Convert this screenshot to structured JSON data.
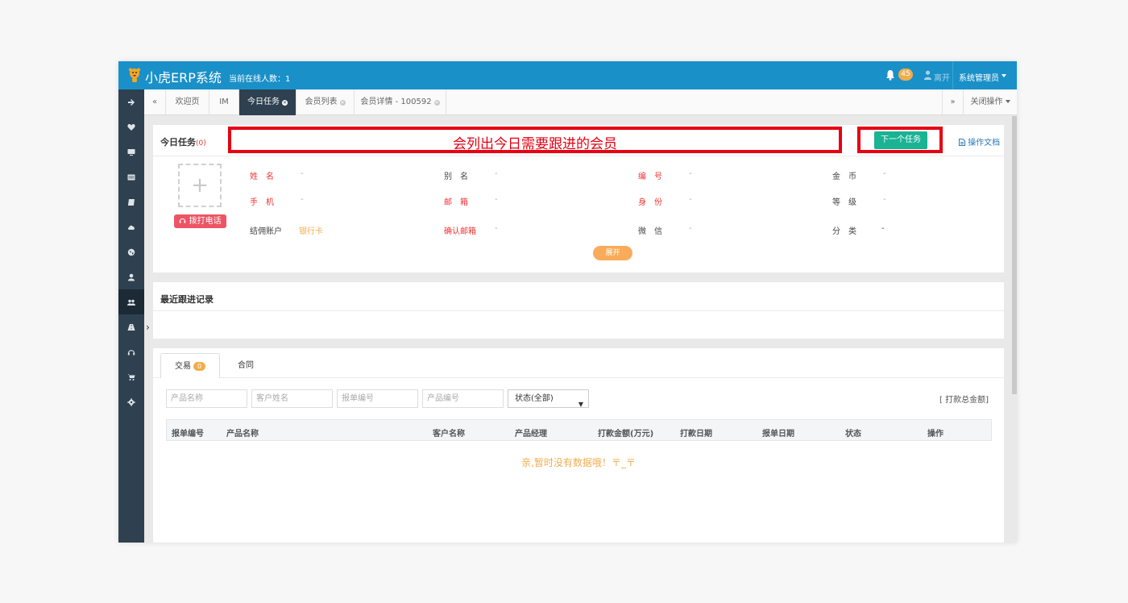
{
  "header": {
    "brand": "小虎ERP系统",
    "online_label": "当前在线人数：1",
    "notification_count": "45",
    "leave_label": "离开",
    "user_menu": "系统管理员",
    "colors": {
      "primary": "#1a90c8",
      "sidebar": "#2f4050",
      "accent": "#1ab394"
    }
  },
  "sidebar": {
    "items": [
      {
        "icon": "arrow-right-icon"
      },
      {
        "icon": "heart-icon"
      },
      {
        "icon": "monitor-icon"
      },
      {
        "icon": "list-icon"
      },
      {
        "icon": "book-icon"
      },
      {
        "icon": "cloud-icon"
      },
      {
        "icon": "globe-icon"
      },
      {
        "icon": "user-icon"
      },
      {
        "icon": "users-icon",
        "active": true
      },
      {
        "icon": "road-icon"
      },
      {
        "icon": "headset-icon"
      },
      {
        "icon": "cart-icon"
      },
      {
        "icon": "settings-icon"
      }
    ]
  },
  "tabs": {
    "prev": "«",
    "items": [
      {
        "label": "欢迎页"
      },
      {
        "label": "IM"
      },
      {
        "label": "今日任务",
        "active": true
      },
      {
        "label": "会员列表"
      },
      {
        "label": "会员详情 - 100592"
      }
    ],
    "next": "»",
    "close_ops": "关闭操作"
  },
  "task_panel": {
    "title": "今日任务",
    "count": "(0)",
    "annotation": "会列出今日需要跟进的会员",
    "next_button": "下一个任务",
    "doc_link": "操作文档",
    "call_button": "拨打电话",
    "fields": [
      {
        "label": "姓　名",
        "value": "-"
      },
      {
        "label": "别　名",
        "value": "-"
      },
      {
        "label": "编　号",
        "value": "-"
      },
      {
        "label": "金　币",
        "value": "-"
      },
      {
        "label": "手　机",
        "value": "-"
      },
      {
        "label": "邮　箱",
        "value": "-"
      },
      {
        "label": "身　份",
        "value": "-"
      },
      {
        "label": "等　级",
        "value": "-"
      },
      {
        "label": "结佣账户",
        "value": "银行卡"
      },
      {
        "label": "确认邮箱",
        "value": "-"
      },
      {
        "label": "微　信",
        "value": "-"
      },
      {
        "label": "分　类",
        "value": "-"
      }
    ],
    "expand_button": "展开"
  },
  "followup_panel": {
    "title": "最近跟进记录"
  },
  "trade_panel": {
    "tabs": [
      {
        "label": "交易",
        "badge": "0"
      },
      {
        "label": "合同"
      }
    ],
    "filters": {
      "product_name": "产品名称",
      "customer_name": "客户姓名",
      "quote_no": "报单编号",
      "product_no": "产品编号",
      "status_selected": "状态(全部)"
    },
    "total_link": "[ 打款总金额]",
    "columns": [
      "报单编号",
      "产品名称",
      "客户名称",
      "产品经理",
      "打款金额(万元)",
      "打款日期",
      "报单日期",
      "状态",
      "操作"
    ],
    "empty_message": "亲,暂时没有数据哦！〒_〒"
  }
}
